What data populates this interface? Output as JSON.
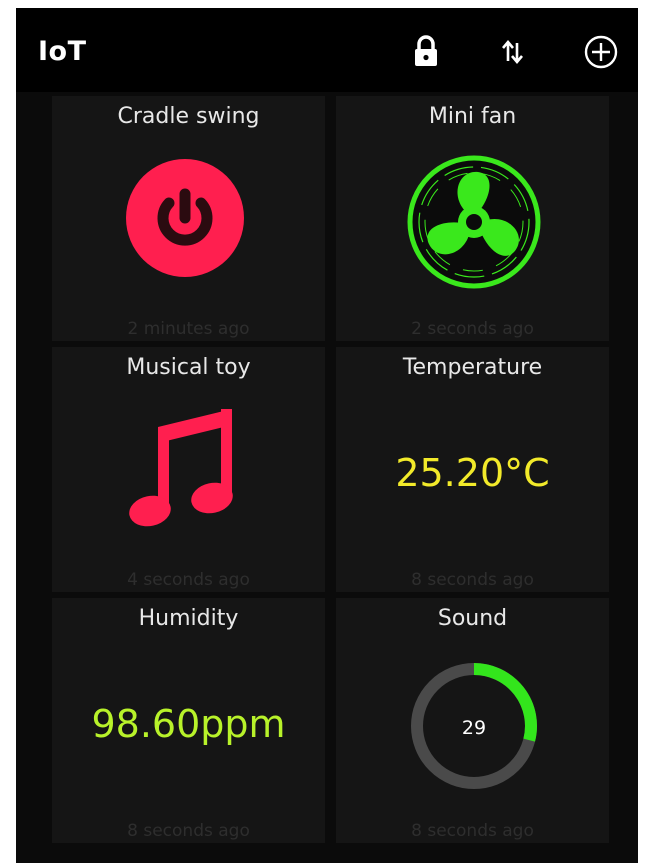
{
  "appbar": {
    "title": "IoT",
    "icons": [
      "lock-icon",
      "sort-arrows-icon",
      "add-circle-icon"
    ]
  },
  "tiles": [
    {
      "title": "Cradle swing",
      "time": "2 minutes ago",
      "icon": "power-icon",
      "color": "#ff1f4f"
    },
    {
      "title": "Mini fan",
      "time": "2 seconds ago",
      "icon": "fan-icon",
      "color": "#3ae81c"
    },
    {
      "title": "Musical toy",
      "time": "4 seconds ago",
      "icon": "music-note-icon",
      "color": "#ff1f4f"
    },
    {
      "title": "Temperature",
      "time": "8 seconds ago",
      "value": "25.20°C",
      "color": "#f2ea2a"
    },
    {
      "title": "Humidity",
      "time": "8 seconds ago",
      "value": "98.60ppm",
      "color": "#b8f22a"
    },
    {
      "title": "Sound",
      "time": "8 seconds ago",
      "gauge_value": "29",
      "gauge_fraction": 0.29,
      "color": "#33e51c",
      "track_color": "#4a4a4a"
    }
  ]
}
